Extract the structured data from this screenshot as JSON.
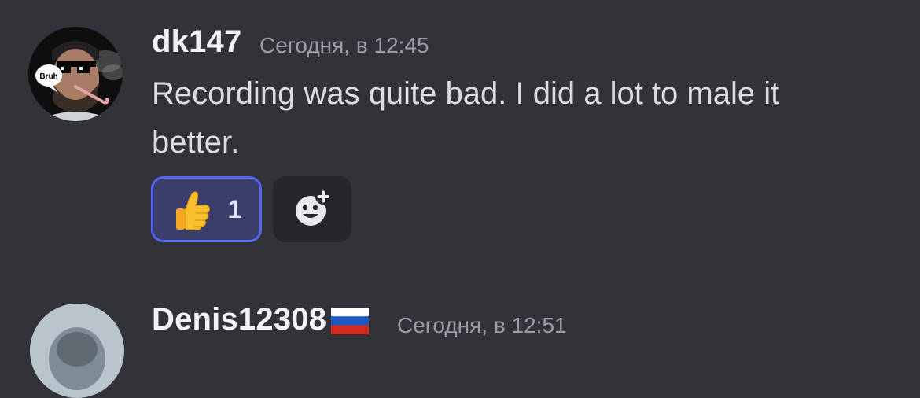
{
  "messages": [
    {
      "username": "dk147",
      "timestamp": "Сегодня, в 12:45",
      "text": "Recording was quite bad. I did a lot to male it better.",
      "avatar_icon": "avatar-sunglasses-candy-cane",
      "avatar_badge_text": "Bruh",
      "reactions": [
        {
          "emoji": "👍",
          "emoji_icon": "thumbs-up-icon",
          "count": "1",
          "selected": true
        }
      ],
      "add_reaction_icon": "add-reaction-icon"
    },
    {
      "username": "Denis12308",
      "username_flag_icon": "russia-flag-icon",
      "timestamp": "Сегодня, в 12:51",
      "avatar_icon": "avatar-user"
    }
  ],
  "colors": {
    "background": "#323339",
    "username": "#f2f3f5",
    "timestamp": "#9a9ca6",
    "message_text": "#dbdee1",
    "reaction_selected_bg": "#3b3e6b",
    "reaction_selected_border": "#5865f2",
    "add_reaction_bg": "#26272c"
  }
}
